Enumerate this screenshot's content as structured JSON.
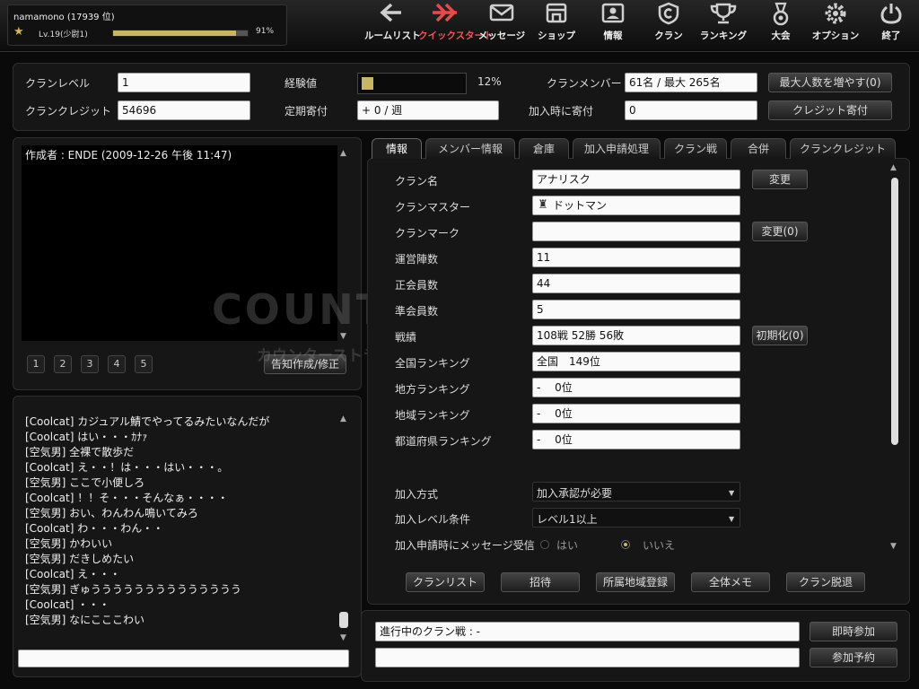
{
  "user": {
    "name": "namamono (17939 位)",
    "level": "Lv.19(少尉1)",
    "exp_fraction": 0.91,
    "exp_percent": "91%"
  },
  "nav": [
    {
      "label": "ルームリスト",
      "icon": "arrow-left-icon"
    },
    {
      "label": "クイックスタート",
      "icon": "fast-forward-icon"
    },
    {
      "label": "メッセージ",
      "icon": "envelope-icon"
    },
    {
      "label": "ショップ",
      "icon": "shop-icon"
    },
    {
      "label": "情報",
      "icon": "id-card-icon"
    },
    {
      "label": "クラン",
      "icon": "clan-shield-icon"
    },
    {
      "label": "ランキング",
      "icon": "trophy-icon"
    },
    {
      "label": "大会",
      "icon": "medal-icon"
    },
    {
      "label": "オプション",
      "icon": "gear-icon"
    },
    {
      "label": "終了",
      "icon": "power-icon"
    }
  ],
  "stats": {
    "clan_level_label": "クランレベル",
    "clan_level": "1",
    "exp_label": "経験値",
    "exp_fraction": 0.12,
    "exp_percent": "12%",
    "members_label": "クランメンバー",
    "members_value": "61名 / 最大 265名",
    "increase_button": "最大人数を増やす(0)",
    "credit_label": "クランクレジット",
    "credit_value": "54696",
    "regular_label": "定期寄付",
    "regular_value": "+ 0 / 週",
    "join_donation_label": "加入時に寄付",
    "join_donation_value": "0",
    "donate_button": "クレジット寄付"
  },
  "notice": {
    "author_line": "作成者 : ENDE (2009-12-26 午後 11:47)",
    "pages": [
      "1",
      "2",
      "3",
      "4",
      "5"
    ],
    "edit_button": "告知作成/修正"
  },
  "chat": {
    "lines": [
      "[Coolcat] カジュアル鯖でやってるみたいなんだが",
      "[Coolcat] はい・・・ｶﾅｧ",
      "[空気男] 全裸で散歩だ",
      "[Coolcat] え・・！は・・・はい・・・。",
      "[空気男] ここで小便しろ",
      "[Coolcat] ！！そ・・・そんなぁ・・・・",
      "[空気男] おい、わんわん鳴いてみろ",
      "[Coolcat] わ・・・わん・・",
      "[空気男] かわいい",
      "[空気男] だきしめたい",
      "[Coolcat] え・・・",
      "[空気男] ぎゅうううううううううううううう",
      "[Coolcat] ・・・",
      "[空気男] なにこここわい"
    ],
    "input_value": ""
  },
  "watermark": {
    "title": "COUNTER-STRIKE",
    "subtitle": "カウンターストライクオンライン"
  },
  "tabs": [
    "情報",
    "メンバー情報",
    "倉庫",
    "加入申請処理",
    "クラン戦",
    "合併",
    "クランクレジット"
  ],
  "info": {
    "rows": [
      {
        "label": "クラン名",
        "value": "アナリスク"
      },
      {
        "label": "クランマスター",
        "value": "ドットマン"
      },
      {
        "label": "クランマーク",
        "value": ""
      },
      {
        "label": "運営陣数",
        "value": "11"
      },
      {
        "label": "正会員数",
        "value": "44"
      },
      {
        "label": "準会員数",
        "value": "5"
      },
      {
        "label": "戦績",
        "value": "108戦 52勝 56敗"
      },
      {
        "label": "全国ランキング",
        "value": "全国　149位"
      },
      {
        "label": "地方ランキング",
        "value": "-　 0位"
      },
      {
        "label": "地域ランキング",
        "value": "-　 0位"
      },
      {
        "label": "都道府県ランキング",
        "value": "-　 0位"
      }
    ],
    "change_button": "変更",
    "change_mark_button": "変更(0)",
    "reset_button": "初期化(0)",
    "join_method_label": "加入方式",
    "join_method_value": "加入承認が必要",
    "join_level_label": "加入レベル条件",
    "join_level_value": "レベル1以上",
    "message_label": "加入申請時にメッセージ受信",
    "option_yes": "はい",
    "option_no": "いいえ",
    "message_selected": "いいえ"
  },
  "actions": [
    "クランリスト",
    "招待",
    "所属地域登録",
    "全体メモ",
    "クラン脱退"
  ],
  "clanwar": {
    "status_text": "進行中のクラン戦 : -",
    "join_now_button": "即時参加",
    "reserve_button": "参加予約",
    "second_field": ""
  },
  "colors": {
    "accent_red": "#e84a4a",
    "exp_bar": "#c9b660",
    "background": "#0a0a0a"
  }
}
